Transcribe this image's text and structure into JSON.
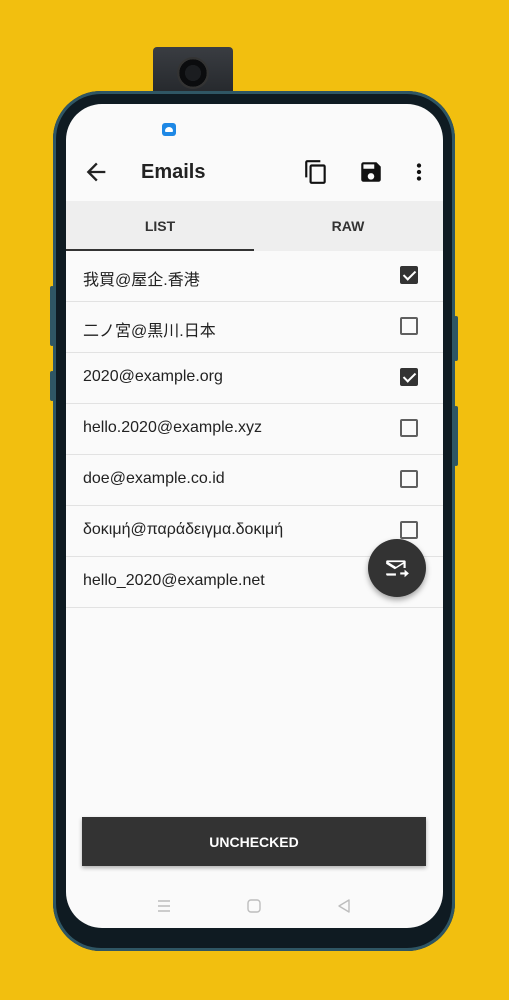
{
  "appbar": {
    "title": "Emails",
    "icons": [
      "back-arrow-icon",
      "copy-icon",
      "save-icon",
      "more-vert-icon"
    ]
  },
  "tabs": [
    {
      "label": "LIST",
      "active": true
    },
    {
      "label": "RAW",
      "active": false
    }
  ],
  "emails": [
    {
      "address": "我買@屋企.香港",
      "checked": true
    },
    {
      "address": "二ノ宮@黒川.日本",
      "checked": false
    },
    {
      "address": "2020@example.org",
      "checked": true
    },
    {
      "address": "hello.2020@example.xyz",
      "checked": false
    },
    {
      "address": "doe@example.co.id",
      "checked": false
    },
    {
      "address": "δοκιμή@παράδειγμα.δοκιμή",
      "checked": false
    },
    {
      "address": "hello_2020@example.net",
      "checked": false
    }
  ],
  "fab": {
    "icon": "send-email-icon"
  },
  "bottom_button": {
    "label": "UNCHECKED"
  },
  "colors": {
    "background": "#F2BF0F",
    "primary_dark": "#333333",
    "notification": "#1E88E5"
  }
}
